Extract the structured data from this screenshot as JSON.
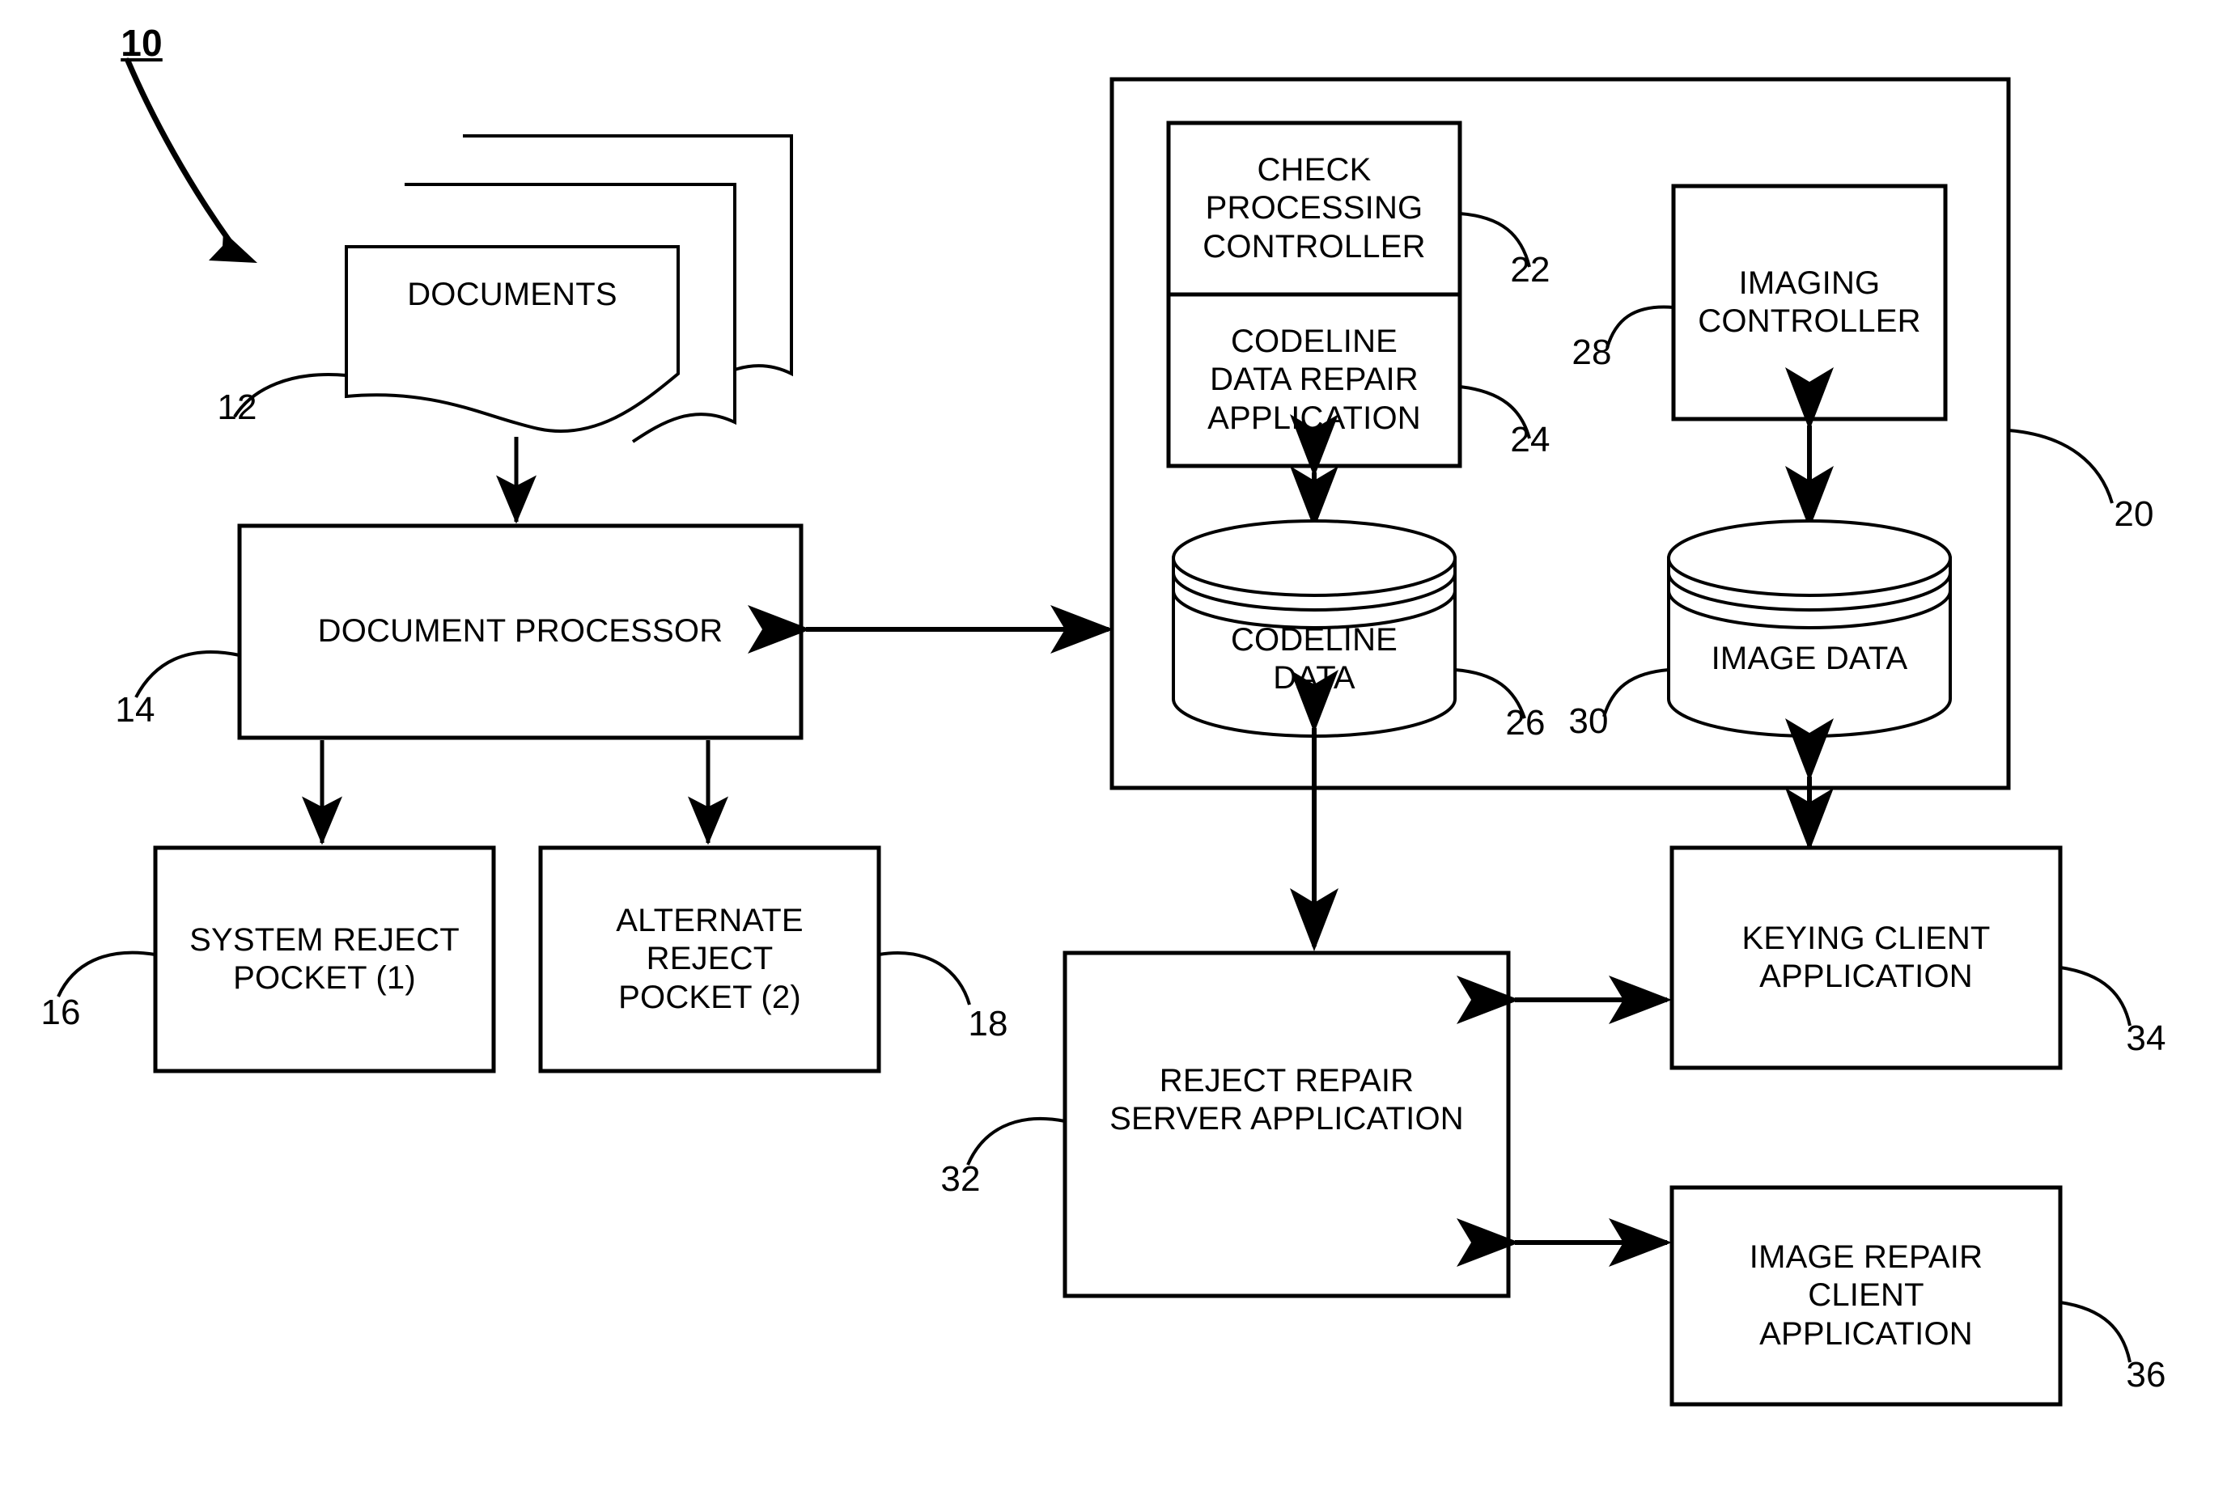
{
  "figure": {
    "reference_label": "10",
    "type": "patent-block-diagram"
  },
  "nodes": {
    "documents": {
      "label": "DOCUMENTS",
      "ref": "12",
      "shape": "stacked-documents"
    },
    "document_processor": {
      "label": "DOCUMENT PROCESSOR",
      "ref": "14",
      "shape": "rectangle"
    },
    "system_reject_pocket": {
      "label": "SYSTEM REJECT\nPOCKET (1)",
      "ref": "16",
      "shape": "rectangle"
    },
    "alternate_reject_pocket": {
      "label": "ALTERNATE\nREJECT\nPOCKET (2)",
      "ref": "18",
      "shape": "rectangle"
    },
    "host_container": {
      "ref": "20",
      "shape": "rectangle"
    },
    "check_processing_controller": {
      "label": "CHECK\nPROCESSING\nCONTROLLER",
      "ref": "22",
      "shape": "rectangle"
    },
    "codeline_data_repair_application": {
      "label": "CODELINE\nDATA REPAIR\nAPPLICATION",
      "ref": "24",
      "shape": "rectangle"
    },
    "codeline_data": {
      "label": "CODELINE\nDATA",
      "ref": "26",
      "shape": "cylinder"
    },
    "imaging_controller": {
      "label": "IMAGING\nCONTROLLER",
      "ref": "28",
      "shape": "rectangle"
    },
    "image_data": {
      "label": "IMAGE DATA",
      "ref": "30",
      "shape": "cylinder"
    },
    "reject_repair_server_application": {
      "label": "REJECT REPAIR\nSERVER APPLICATION",
      "ref": "32",
      "shape": "rectangle"
    },
    "keying_client_application": {
      "label": "KEYING CLIENT\nAPPLICATION",
      "ref": "34",
      "shape": "rectangle"
    },
    "image_repair_client_application": {
      "label": "IMAGE REPAIR\nCLIENT\nAPPLICATION",
      "ref": "36",
      "shape": "rectangle"
    }
  },
  "connectors": [
    {
      "name": "documents-to-document-processor",
      "from": "documents",
      "to": "document_processor",
      "style": "single-arrow-down"
    },
    {
      "name": "document-processor-to-system-reject-pocket",
      "from": "document_processor",
      "to": "system_reject_pocket",
      "style": "single-arrow-down"
    },
    {
      "name": "document-processor-to-alternate-reject-pocket",
      "from": "document_processor",
      "to": "alternate_reject_pocket",
      "style": "single-arrow-down"
    },
    {
      "name": "document-processor-to-host",
      "from": "document_processor",
      "to": "host_container",
      "style": "double-arrow-horizontal"
    },
    {
      "name": "codeline-repair-to-codeline-data",
      "from": "codeline_data_repair_application",
      "to": "codeline_data",
      "style": "double-arrow-vertical"
    },
    {
      "name": "imaging-controller-to-image-data",
      "from": "imaging_controller",
      "to": "image_data",
      "style": "double-arrow-vertical"
    },
    {
      "name": "codeline-data-to-reject-repair-server",
      "from": "codeline_data",
      "to": "reject_repair_server_application",
      "style": "double-arrow-vertical"
    },
    {
      "name": "host-to-keying-client",
      "from": "host_container",
      "to": "keying_client_application",
      "style": "double-arrow-vertical"
    },
    {
      "name": "reject-repair-server-to-keying-client",
      "from": "reject_repair_server_application",
      "to": "keying_client_application",
      "style": "double-arrow-horizontal"
    },
    {
      "name": "reject-repair-server-to-image-repair-client",
      "from": "reject_repair_server_application",
      "to": "image_repair_client_application",
      "style": "double-arrow-horizontal"
    }
  ],
  "style": {
    "stroke": "#000000",
    "background": "#ffffff"
  }
}
